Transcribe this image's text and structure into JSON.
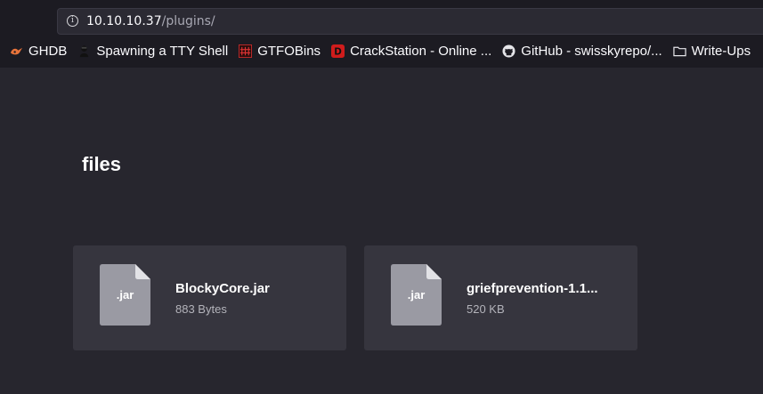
{
  "browser": {
    "url_host": "10.10.10.37",
    "url_path": "/plugins/",
    "bookmarks": [
      {
        "label": "GHDB",
        "icon": "ghdb-icon"
      },
      {
        "label": "Spawning a TTY Shell",
        "icon": "tty-shell-icon"
      },
      {
        "label": "GTFOBins",
        "icon": "gtfobins-icon"
      },
      {
        "label": "CrackStation - Online ...",
        "icon": "crackstation-icon"
      },
      {
        "label": "GitHub - swisskyrepo/...",
        "icon": "github-icon"
      },
      {
        "label": "Write-Ups",
        "icon": "folder-icon"
      }
    ]
  },
  "page": {
    "heading": "files",
    "files": [
      {
        "ext": ".jar",
        "name": "BlockyCore.jar",
        "size": "883 Bytes"
      },
      {
        "ext": ".jar",
        "name": "griefprevention-1.1...",
        "size": "520 KB"
      }
    ]
  },
  "colors": {
    "background": "#27262e",
    "card": "#36353e",
    "file_icon": "#9a9aa3"
  }
}
